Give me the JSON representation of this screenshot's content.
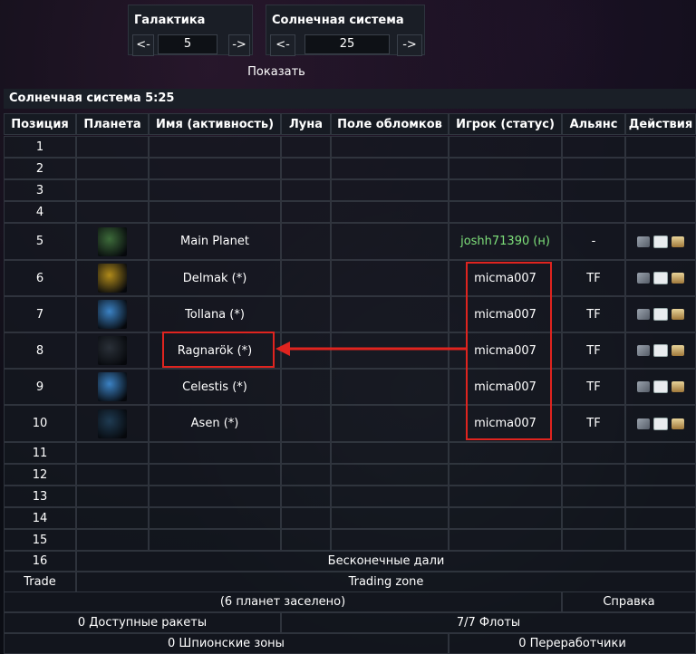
{
  "nav": {
    "galaxy_label": "Галактика",
    "galaxy_value": "5",
    "system_label": "Солнечная система",
    "system_value": "25",
    "prev_label": "<-",
    "next_label": "->",
    "show_label": "Показать"
  },
  "system_title": "Солнечная система 5:25",
  "headers": [
    "Позиция",
    "Планета",
    "Имя (активность)",
    "Луна",
    "Поле обломков",
    "Игрок (статус)",
    "Альянс",
    "Действия"
  ],
  "rows": [
    {
      "pos": "1",
      "name": "",
      "player": "",
      "alliance": "",
      "planet": "",
      "actions": false
    },
    {
      "pos": "2",
      "name": "",
      "player": "",
      "alliance": "",
      "planet": "",
      "actions": false
    },
    {
      "pos": "3",
      "name": "",
      "player": "",
      "alliance": "",
      "planet": "",
      "actions": false
    },
    {
      "pos": "4",
      "name": "",
      "player": "",
      "alliance": "",
      "planet": "",
      "actions": false
    },
    {
      "pos": "5",
      "name": "Main Planet",
      "player": "joshh71390",
      "status": "(н)",
      "alliance": "-",
      "planet": "green-planet",
      "actions": true
    },
    {
      "pos": "6",
      "name": "Delmak (*)",
      "player": "micma007",
      "alliance": "TF",
      "planet": "gold-planet",
      "actions": true
    },
    {
      "pos": "7",
      "name": "Tollana (*)",
      "player": "micma007",
      "alliance": "TF",
      "planet": "blue-planet",
      "actions": true
    },
    {
      "pos": "8",
      "name": "Ragnarök (*)",
      "player": "micma007",
      "alliance": "TF",
      "planet": "dark-planet",
      "actions": true
    },
    {
      "pos": "9",
      "name": "Celestis (*)",
      "player": "micma007",
      "alliance": "TF",
      "planet": "blue-planet",
      "actions": true
    },
    {
      "pos": "10",
      "name": "Asen (*)",
      "player": "micma007",
      "alliance": "TF",
      "planet": "dark-blue-planet",
      "actions": true
    },
    {
      "pos": "11",
      "name": "",
      "player": "",
      "alliance": "",
      "planet": "",
      "actions": false
    },
    {
      "pos": "12",
      "name": "",
      "player": "",
      "alliance": "",
      "planet": "",
      "actions": false
    },
    {
      "pos": "13",
      "name": "",
      "player": "",
      "alliance": "",
      "planet": "",
      "actions": false
    },
    {
      "pos": "14",
      "name": "",
      "player": "",
      "alliance": "",
      "planet": "",
      "actions": false
    },
    {
      "pos": "15",
      "name": "",
      "player": "",
      "alliance": "",
      "planet": "",
      "actions": false
    }
  ],
  "row16": {
    "pos": "16",
    "text": "Бесконечные дали"
  },
  "trade": {
    "pos": "Trade",
    "text": "Trading zone"
  },
  "footer": {
    "planets_settled": "(6 планет заселено)",
    "help": "Справка",
    "missiles": "0 Доступные ракеты",
    "fleets": "7/7 Флоты",
    "spy_zones": "0 Шпионские зоны",
    "recyclers": "0 Переработчики"
  },
  "planet_colors": {
    "green-planet": "#3d6b3a",
    "gold-planet": "#b08a1a",
    "blue-planet": "#3b82c4",
    "dark-planet": "#2a3038",
    "dark-blue-planet": "#1f3b52"
  },
  "colors": {
    "highlight_red": "#e0241f",
    "player_new": "#7ee07a"
  }
}
